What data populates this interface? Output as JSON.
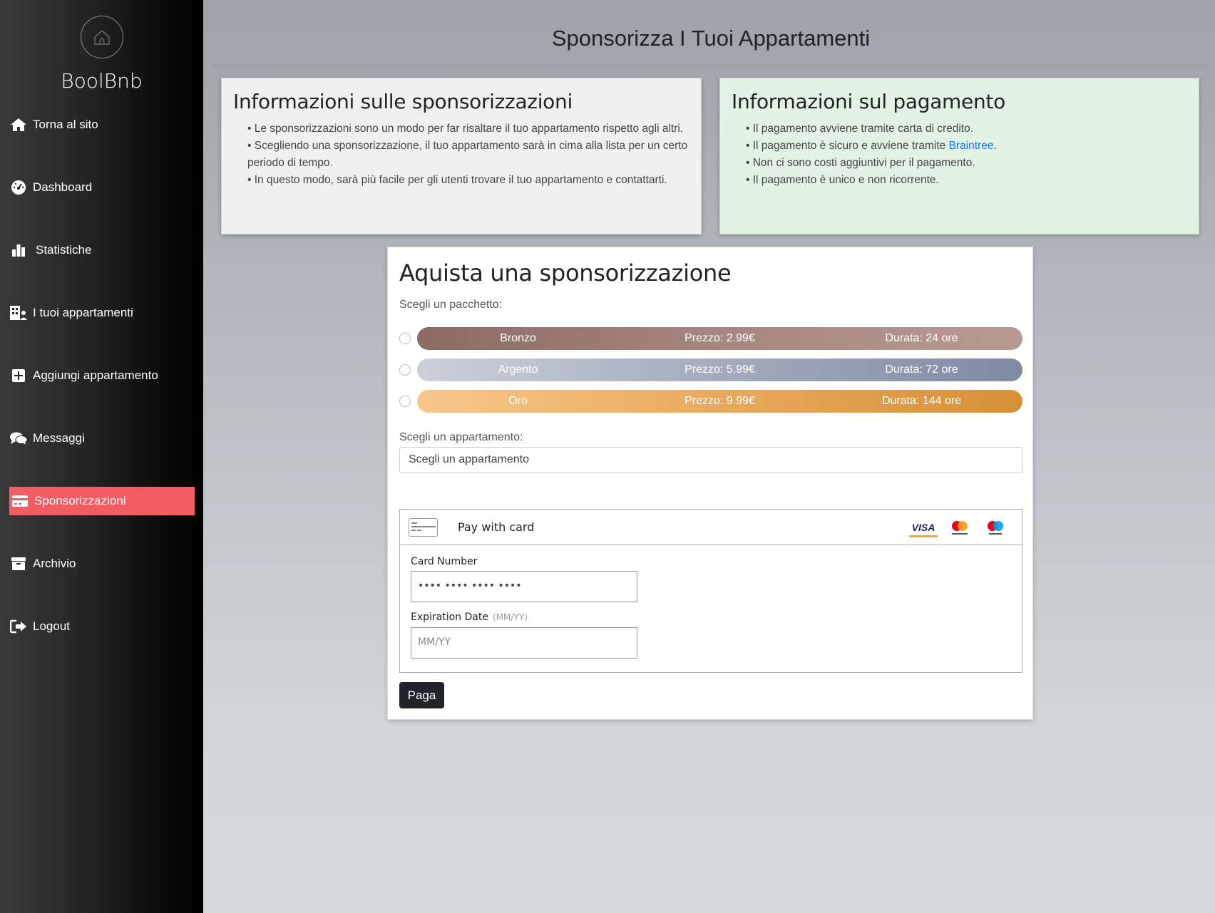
{
  "sidebar": {
    "brand": "BoolBnb",
    "items": [
      {
        "label": "Torna al sito",
        "icon": "home-icon"
      },
      {
        "label": "Dashboard",
        "icon": "gauge-icon"
      },
      {
        "label": "Statistiche",
        "icon": "bar-chart-icon"
      },
      {
        "label": "I tuoi appartamenti",
        "icon": "building-icon"
      },
      {
        "label": "Aggiungi appartamento",
        "icon": "plus-square-icon"
      },
      {
        "label": "Messaggi",
        "icon": "comments-icon"
      },
      {
        "label": "Sponsorizzazioni",
        "icon": "credit-card-icon",
        "active": true
      },
      {
        "label": "Archivio",
        "icon": "archive-icon"
      },
      {
        "label": "Logout",
        "icon": "logout-icon"
      }
    ],
    "active_color": "#f25c63"
  },
  "main": {
    "title": "Sponsorizza I Tuoi Appartamenti",
    "info_sponsor": {
      "title": "Informazioni sulle sponsorizzazioni",
      "points": [
        "• Le sponsorizzazioni sono un modo per far risaltare il tuo appartamento rispetto agli altri.",
        "• Scegliendo una sponsorizzazione, il tuo appartamento sarà in cima alla lista per un certo periodo di tempo.",
        "• In questo modo, sarà più facile per gli utenti trovare il tuo appartamento e contattarti."
      ]
    },
    "info_payment": {
      "title": "Informazioni sul pagamento",
      "points": [
        "• Il pagamento avviene tramite carta di credito.",
        "• Il pagamento è sicuro e avviene tramite ",
        "• Non ci sono costi aggiuntivi per il pagamento.",
        "• Il pagamento è unico e non ricorrente."
      ],
      "link_text": "Braintree",
      "link_suffix": "."
    },
    "buy": {
      "title": "Aquista una sponsorizzazione",
      "package_label": "Scegli un pacchetto:",
      "packages": [
        {
          "name": "Bronzo",
          "price": "Prezzo: 2.99€",
          "duration": "Durata: 24 ore"
        },
        {
          "name": "Argento",
          "price": "Prezzo: 5.99€",
          "duration": "Durata: 72 ore"
        },
        {
          "name": "Oro",
          "price": "Prezzo: 9.99€",
          "duration": "Durata: 144 ore"
        }
      ],
      "apartment_label": "Scegli un appartamento:",
      "apartment_select": "Scegli un appartamento",
      "payment": {
        "header": "Pay with card",
        "card_number_label": "Card Number",
        "card_number_value": "•••• •••• •••• ••••",
        "expiration_label": "Expiration Date",
        "expiration_hint": "(MM/YY)",
        "expiration_placeholder": "MM/YY",
        "brands": [
          "VISA",
          "mastercard",
          "maestro"
        ]
      },
      "submit": "Paga"
    }
  }
}
